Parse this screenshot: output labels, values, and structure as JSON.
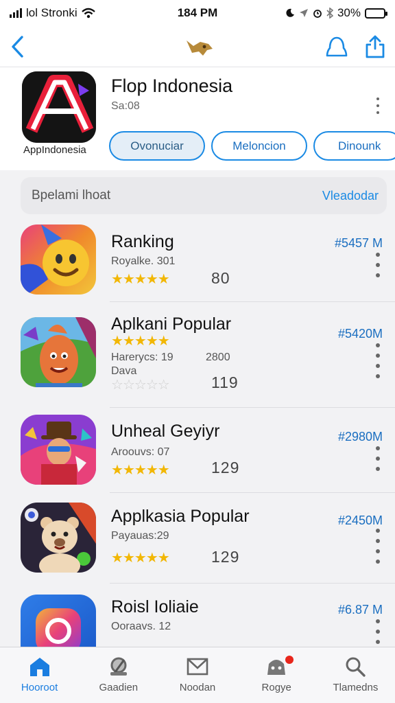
{
  "status": {
    "carrier": "lol Stronki",
    "time": "184 PM",
    "battery": "30%",
    "battery_level": 0.3
  },
  "nav": {
    "back_icon": "chevron-left-icon",
    "logo_icon": "bird-logo-icon",
    "account_icon": "account-icon",
    "share_icon": "share-icon"
  },
  "featured": {
    "title": "Flop Indonesia",
    "subtitle": "Sa:08",
    "icon_caption": "AppIndonesia",
    "pills": [
      "Ovonuciar",
      "Meloncion",
      "Dinounk"
    ]
  },
  "search": {
    "label": "Bpelami lhoat",
    "action": "Vleadodar"
  },
  "apps": [
    {
      "name": "Ranking",
      "sub": "Royalke. 301",
      "price": "#5457 M",
      "rank": "80",
      "rating": 4.5
    },
    {
      "name": "Aplkani Popular",
      "sub": "Harerycs: 19",
      "sub2": "Dava",
      "extra": "2800",
      "price": "#5420M",
      "rank": "119",
      "rating": 4.5,
      "rating2": 0
    },
    {
      "name": "Unheal Geyiyr",
      "sub": "Aroouvs: 07",
      "price": "#2980M",
      "rank": "129",
      "rating": 4.5
    },
    {
      "name": "Applkasia Popular",
      "sub": "Payauas:29",
      "price": "#2450M",
      "rank": "129",
      "rating": 4.5
    },
    {
      "name": "Roisl Ioliaie",
      "sub": "Ooraavs. 12",
      "price": "#6.87 M"
    }
  ],
  "tabs": [
    {
      "label": "Hooroot",
      "icon": "home-icon",
      "active": true
    },
    {
      "label": "Gaadien",
      "icon": "games-icon",
      "active": false
    },
    {
      "label": "Noodan",
      "icon": "mail-icon",
      "active": false
    },
    {
      "label": "Rogye",
      "icon": "arcade-icon",
      "active": false,
      "badge": true
    },
    {
      "label": "Tlamedns",
      "icon": "search-icon",
      "active": false
    }
  ],
  "colors": {
    "accent": "#1a8ae4",
    "star": "#f2b705",
    "badge": "#e8261c"
  }
}
